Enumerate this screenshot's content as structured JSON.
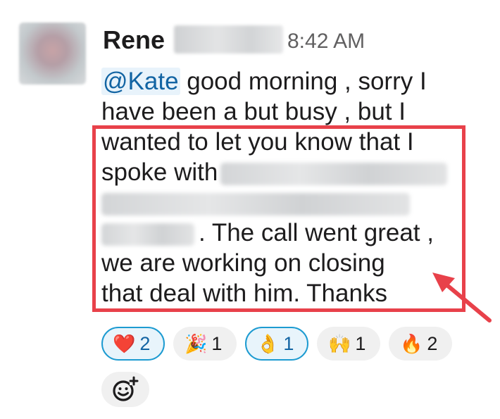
{
  "message": {
    "sender": "Rene",
    "timestamp": "8:42 AM",
    "mention": "@Kate",
    "lines": [
      " good morning , sorry I",
      "have been a but busy , but I",
      "wanted to let you know that I",
      "spoke with",
      ". The call went great ,",
      "we are working on closing",
      "that deal with him. Thanks"
    ]
  },
  "reactions": [
    {
      "emoji": "❤️",
      "icon": "heart-icon",
      "count": "2",
      "active": true
    },
    {
      "emoji": "🎉",
      "icon": "party-popper-icon",
      "count": "1",
      "active": false
    },
    {
      "emoji": "👌",
      "icon": "ok-hand-icon",
      "count": "1",
      "active": true
    },
    {
      "emoji": "🙌",
      "icon": "raised-hands-icon",
      "count": "1",
      "active": false
    },
    {
      "emoji": "🔥",
      "icon": "fire-icon",
      "count": "2",
      "active": false
    }
  ],
  "colors": {
    "highlight": "#e8414a",
    "mention": "#1264a3",
    "active_reaction_border": "#1d9bd1"
  },
  "add_reaction_icon": "add-emoji-icon"
}
